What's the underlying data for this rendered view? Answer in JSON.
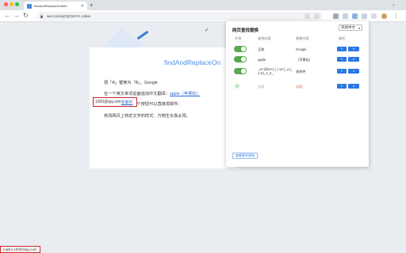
{
  "tab": {
    "title": "findAndReplaceOnWeb"
  },
  "toolbar": {
    "url": "wer.cn/umjCQOmYH ,cdeie"
  },
  "colors": {
    "accent": "#2b78e4",
    "toggle_on": "#5aa84f",
    "highlight_red": "#c62828"
  },
  "page": {
    "title": "findAndReplaceOn",
    "line1": "把「A」替换为「B」、Google",
    "line2_prefix": "在一个英文单词后面追加中文翻译：",
    "line2_link": "apple（苹果松）",
    "line3_prefix": "在邮箱后面增加一个按钮可以直接发邮件：",
    "email_value": "1000@qq.com",
    "email_link": "发邮件",
    "line4": "修改网页上特定文字的样式：万物生长靠太阳。"
  },
  "popup": {
    "title": "网页查找替换",
    "add_select": "添加中文",
    "headers": {
      "enabled": "开关",
      "find": "查找内容",
      "replace": "替换内容",
      "actions": "操作"
    },
    "rows": [
      {
        "on": true,
        "find": "互联",
        "replace": "Google",
        "replace_style": "normal"
      },
      {
        "on": true,
        "find": "apple",
        "replace": "（苹果松）",
        "replace_style": "normal"
      },
      {
        "on": true,
        "find": "_w+@(w+).(_\\.w+)_x-(_z.xr)_1_2_",
        "replace": "发邮件",
        "replace_style": "normal"
      },
      {
        "on": false,
        "find": "太阳",
        "replace": "太阳",
        "replace_style": "red"
      }
    ],
    "footer_button": "查看更多规则"
  },
  "statusbar": {
    "text": "mailto:1000@qq.com"
  }
}
